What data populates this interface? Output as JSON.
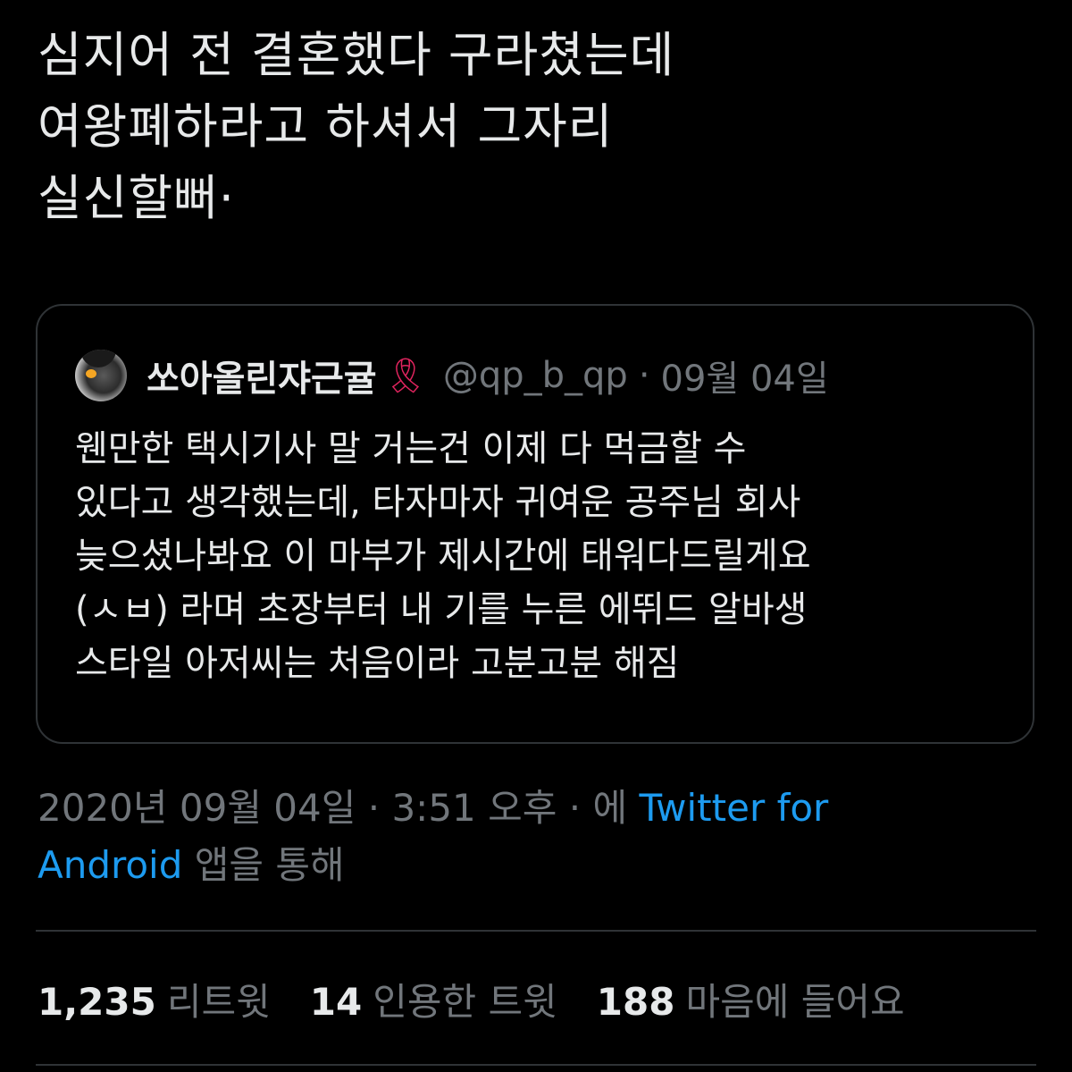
{
  "tweet": {
    "text_lines": [
      "심지어 전 결혼했다 구라쳤는데",
      "여왕폐하라고 하셔서 그자리",
      "실신할뻐·"
    ]
  },
  "quote": {
    "name": "쏘아올린쟈근귤",
    "ribbon": "🎗",
    "handle": "@qp_b_qp",
    "separator": "·",
    "date": "09월 04일",
    "body_lines": [
      "웬만한 택시기사 말 거는건 이제 다 먹금할 수",
      "있다고 생각했는데, 타자마자 귀여운 공주님 회사",
      "늦으셨나봐요 이 마부가 제시간에 태워다드릴게요",
      "(ㅅㅂ) 라며 초장부터 내 기를 누른 에뛰드 알바생",
      "스타일 아저씨는 처음이라 고분고분 해짐"
    ]
  },
  "meta": {
    "datetime": "2020년 09월 04일 · 3:51 오후 · 에",
    "source_part1": "Twitter for",
    "source_part2": "Android",
    "suffix": "앱을 통해"
  },
  "stats": {
    "retweets_count": "1,235",
    "retweets_label": "리트윗",
    "quotes_count": "14",
    "quotes_label": "인용한 트윗",
    "likes_count": "188",
    "likes_label": "마음에 들어요"
  },
  "colors": {
    "background": "#000000",
    "text": "#e7e9ea",
    "muted": "#71767b",
    "link": "#1d9bf0",
    "border": "#2f3336",
    "ribbon": "#e0245e"
  }
}
